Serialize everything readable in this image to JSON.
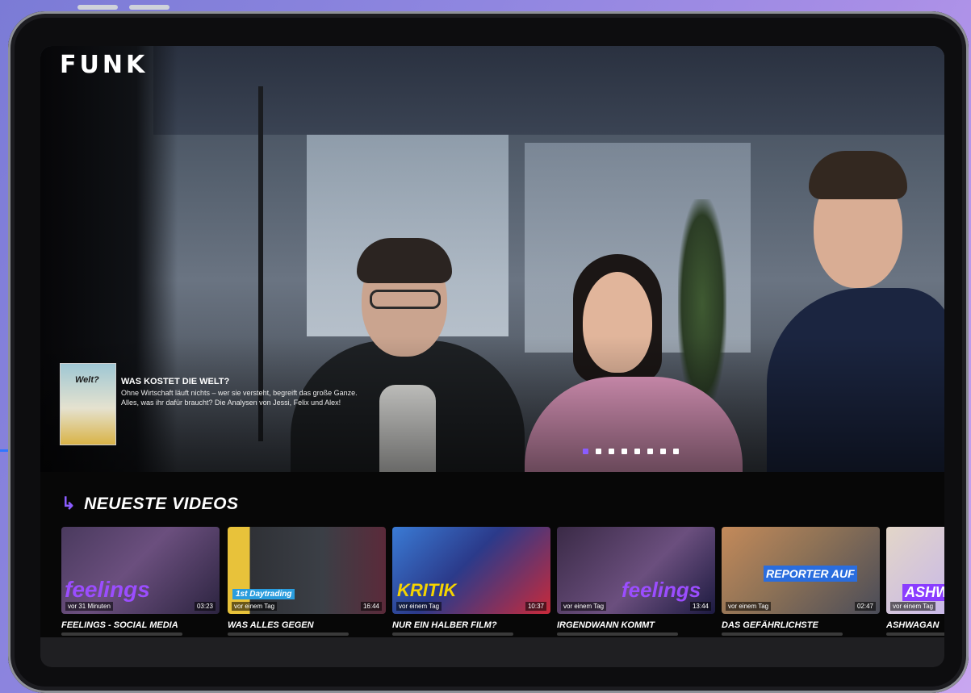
{
  "app": {
    "logo": "FUNK"
  },
  "hero": {
    "promo_title": "WAS KOSTET DIE WELT?",
    "promo_description": "Ohne Wirtschaft läuft nichts – wer sie versteht, begreift das große Ganze. Alles, was ihr dafür braucht? Die Analysen von Jessi, Felix und Alex!",
    "promo_thumb_text": "Welt?",
    "slide_count": 8,
    "active_slide": 1
  },
  "section": {
    "title": "NEUESTE VIDEOS",
    "arrow": "↳"
  },
  "videos": [
    {
      "title": "FEELINGS - SOCIAL MEDIA",
      "age": "vor 31 Minuten",
      "duration": "03:23",
      "overlay": "feelings"
    },
    {
      "title": "WAS ALLES GEGEN",
      "age": "vor einem Tag",
      "duration": "16:44",
      "overlay": "1st Daytrading"
    },
    {
      "title": "NUR EIN HALBER FILM?",
      "age": "vor einem Tag",
      "duration": "10:37",
      "overlay": "KRITIK"
    },
    {
      "title": "IRGENDWANN KOMMT",
      "age": "vor einem Tag",
      "duration": "13:44",
      "overlay": "feelings"
    },
    {
      "title": "DAS GEFÄHRLICHSTE",
      "age": "vor einem Tag",
      "duration": "02:47",
      "overlay": "REPORTER AUF"
    },
    {
      "title": "ASHWAGAN",
      "age": "vor einem Tag",
      "duration": "",
      "overlay": "ASHWA"
    }
  ],
  "colors": {
    "accent": "#8a5cff",
    "screen_bg": "#070707"
  }
}
